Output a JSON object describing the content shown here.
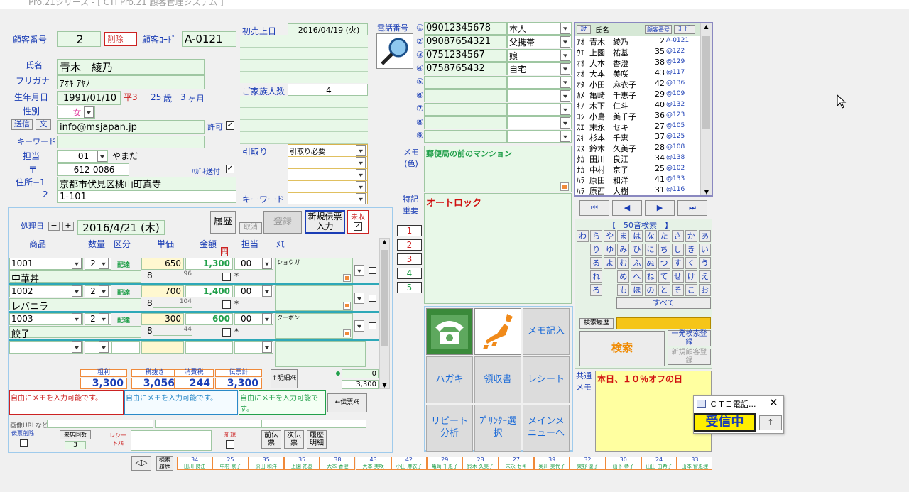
{
  "window": {
    "title": "Pro.21シリーズ - [ CTI Pro.21 顧客管理システム ]"
  },
  "customer": {
    "no_label": "顧客番号",
    "no": "2",
    "delete_label": "削除",
    "code_label": "顧客ｺｰﾄﾞ",
    "code": "A-0121",
    "name_label": "氏名",
    "name": "青木　綾乃",
    "kana_label": "フリガナ",
    "kana": "ｱｵｷ ｱﾔﾉ",
    "birth_label": "生年月日",
    "birth": "1991/01/10",
    "era": "平3",
    "age": "25",
    "age_unit": "歳",
    "months": "3",
    "months_unit": "ヶ月",
    "gender_label": "性別",
    "gender": "女",
    "send_label": "送信",
    "text_label": "文",
    "email": "info@msjapan.jp",
    "permit_label": "許可",
    "keyword_label": "キーワード",
    "staff_label": "担当",
    "staff_code": "01",
    "staff_name": "やまだ",
    "zip_label": "〒",
    "zip": "612-0086",
    "postcard_label": "ﾊｶﾞｷ送付",
    "address1_label": "住所−1",
    "address1": "京都市伏見区桃山町真寺",
    "address2_label": "2",
    "address2": "1-101"
  },
  "info": {
    "first_sale_label": "初売上日",
    "first_sale": "2016/04/19 (火)",
    "family_label": "ご家族人数",
    "family": "4",
    "pickup_label": "引取り",
    "pickup": "引取り必要",
    "keyword2_label": "キーワード"
  },
  "phones": {
    "label": "電話番号",
    "items": [
      {
        "mark": "①",
        "num": "09012345678",
        "type": "本人"
      },
      {
        "mark": "②",
        "num": "09087654321",
        "type": "父携帯"
      },
      {
        "mark": "③",
        "num": "0751234567",
        "type": "娘"
      },
      {
        "mark": "④",
        "num": "0758765432",
        "type": "自宅"
      },
      {
        "mark": "⑤",
        "num": "",
        "type": ""
      },
      {
        "mark": "⑥",
        "num": "",
        "type": ""
      },
      {
        "mark": "⑦",
        "num": "",
        "type": ""
      },
      {
        "mark": "⑧",
        "num": "",
        "type": ""
      },
      {
        "mark": "⑨",
        "num": "",
        "type": ""
      }
    ],
    "memo_label": "メモ(色)",
    "memo": "郵便局の前のマンション",
    "special_label": "特記重要",
    "special": "オートロック",
    "common_label": "共通メモ",
    "common": "本日、１０％オフの日"
  },
  "list": {
    "col_kana": "ｶﾅ",
    "col_name": "氏名",
    "col_no": "顧客番号",
    "col_code": "ｺｰﾄﾞ",
    "rows": [
      {
        "k": "ｱｵ",
        "n": "青木　綾乃",
        "no": "2",
        "c": "A-0121"
      },
      {
        "k": "ｳｴ",
        "n": "上園　祐基",
        "no": "35",
        "c": "@122"
      },
      {
        "k": "ｵｵ",
        "n": "大本　香澄",
        "no": "38",
        "c": "@129"
      },
      {
        "k": "ｵｵ",
        "n": "大本　美咲",
        "no": "43",
        "c": "@117"
      },
      {
        "k": "ｵﾀ",
        "n": "小田　麻衣子",
        "no": "42",
        "c": "@136"
      },
      {
        "k": "ｶﾒ",
        "n": "亀崎　千恵子",
        "no": "29",
        "c": "@109"
      },
      {
        "k": "ｷﾉ",
        "n": "木下　仁斗",
        "no": "40",
        "c": "@132"
      },
      {
        "k": "ｺｼ",
        "n": "小島　美千子",
        "no": "36",
        "c": "@123"
      },
      {
        "k": "ｽｴ",
        "n": "末永　セキ",
        "no": "27",
        "c": "@105"
      },
      {
        "k": "ｽｷ",
        "n": "杉本　千恵",
        "no": "37",
        "c": "@125"
      },
      {
        "k": "ｽｽ",
        "n": "鈴木　久美子",
        "no": "28",
        "c": "@108"
      },
      {
        "k": "ﾀｶ",
        "n": "田川　良江",
        "no": "34",
        "c": "@138"
      },
      {
        "k": "ﾅｶ",
        "n": "中村　京子",
        "no": "25",
        "c": "@102"
      },
      {
        "k": "ﾊﾗ",
        "n": "原田　和洋",
        "no": "41",
        "c": "@133"
      },
      {
        "k": "ﾊﾗ",
        "n": "原西　大樹",
        "no": "31",
        "c": "@116"
      }
    ]
  },
  "kana_search": {
    "title": "【　50音検索　】",
    "rows": [
      [
        "わ",
        "ら",
        "や",
        "ま",
        "は",
        "な",
        "た",
        "さ",
        "か",
        "あ"
      ],
      [
        "",
        "り",
        "ゆ",
        "み",
        "ひ",
        "に",
        "ち",
        "し",
        "き",
        "い"
      ],
      [
        "",
        "る",
        "よ",
        "む",
        "ふ",
        "ぬ",
        "つ",
        "す",
        "く",
        "う"
      ],
      [
        "",
        "れ",
        "",
        "め",
        "へ",
        "ね",
        "て",
        "せ",
        "け",
        "え"
      ],
      [
        "",
        "ろ",
        "",
        "も",
        "ほ",
        "の",
        "と",
        "そ",
        "こ",
        "お"
      ]
    ],
    "all": "すべて",
    "history_label": "検索履歴",
    "search": "検索",
    "one_search": "一発検索登録",
    "new_register": "新規顧客登録"
  },
  "slip": {
    "date_label": "処理日",
    "date": "2016/4/21 (木)",
    "history_btn": "履歴",
    "cancel_btn": "取消",
    "register_btn": "登録",
    "new_btn": "新規伝票入力",
    "unpaid_label": "未収",
    "cols": {
      "item": "商品",
      "qty": "数量",
      "kind": "区分",
      "price": "単価",
      "amount": "金額",
      "staff": "担当",
      "memo": "ﾒﾓ"
    },
    "tax_mark": "円",
    "lines": [
      {
        "code": "1001",
        "name": "中華丼",
        "qty": "2",
        "kind": "配達",
        "price": "650",
        "amount": "1,300",
        "staff": "00",
        "tax": "8",
        "cost": "96",
        "memo": "ショウガ"
      },
      {
        "code": "1002",
        "name": "レバニラ",
        "qty": "2",
        "kind": "配達",
        "price": "700",
        "amount": "1,400",
        "staff": "00",
        "tax": "8",
        "cost": "104",
        "memo": ""
      },
      {
        "code": "1003",
        "name": "餃子",
        "qty": "2",
        "kind": "配達",
        "price": "300",
        "amount": "600",
        "staff": "00",
        "tax": "8",
        "cost": "44",
        "memo": "クーポン"
      }
    ],
    "star": "*",
    "totals": {
      "profit_label": "粗利",
      "profit": "3,300",
      "net_label": "税抜き",
      "net": "3,056",
      "tax_label": "消費税",
      "tax": "244",
      "total_label": "伝票計",
      "total": "3,300"
    },
    "detail_btn": "↑明細ﾒﾓ",
    "side_qty": "0",
    "side_total": "3,300",
    "free_memo1": "自由にメモを入力可能です。",
    "free_memo2": "自由にメモを入力可能です。",
    "free_memo3": "自由にメモを入力可能です。",
    "slip_memo_btn": "←伝票ﾒﾓ",
    "image_url_label": "画像URLなど",
    "slip_delete_label": "伝票削除",
    "visits_label": "来店回数",
    "visits": "3",
    "receipt_memo_label": "レシートﾒﾓ",
    "new_label": "新規",
    "prev_btn": "前伝票",
    "next_btn": "次伝票",
    "hist_detail_btn": "履歴明細"
  },
  "num_buttons": [
    "1",
    "2",
    "3",
    "4",
    "5"
  ],
  "nav": [
    "⏮",
    "◀",
    "▶",
    "⏭"
  ],
  "actions": {
    "memo": "メモ記入",
    "postcard": "ハガキ",
    "receipt": "領収書",
    "receipt2": "レシート",
    "repeat": "リピート分析",
    "printer": "ﾌﾟﾘﾝﾀｰ選択",
    "main_menu": "メインメニューへ"
  },
  "popup": {
    "title": "ＣＴＩ電話...",
    "state": "受信中",
    "up": "↑"
  },
  "history_btn": "検索履歴",
  "history_bar": [
    {
      "num": "34",
      "name": "田川 良江"
    },
    {
      "num": "25",
      "name": "中村 京子"
    },
    {
      "num": "35",
      "name": "原田 和洋"
    },
    {
      "num": "35",
      "name": "上園 祐基"
    },
    {
      "num": "38",
      "name": "大本 香澄"
    },
    {
      "num": "43",
      "name": "大本 美咲"
    },
    {
      "num": "42",
      "name": "小田 麻衣子"
    },
    {
      "num": "29",
      "name": "亀崎 千恵子"
    },
    {
      "num": "28",
      "name": "鈴木 久美子"
    },
    {
      "num": "27",
      "name": "末永 セキ"
    },
    {
      "num": "39",
      "name": "奥川 美代子"
    },
    {
      "num": "32",
      "name": "東野 優子"
    },
    {
      "num": "30",
      "name": "山下 恭子"
    },
    {
      "num": "24",
      "name": "山田 由希子"
    },
    {
      "num": "33",
      "name": "山本 智恵理"
    }
  ]
}
